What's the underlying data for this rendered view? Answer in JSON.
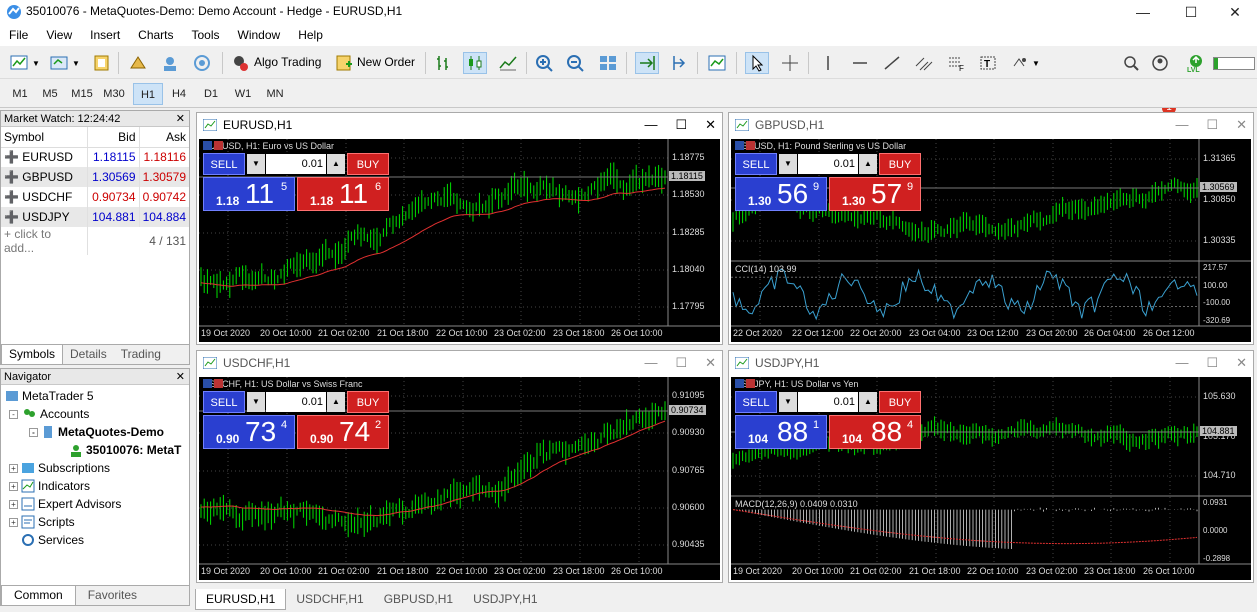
{
  "window": {
    "title": "35010076 - MetaQuotes-Demo: Demo Account - Hedge - EURUSD,H1"
  },
  "menu": [
    "File",
    "View",
    "Insert",
    "Charts",
    "Tools",
    "Window",
    "Help"
  ],
  "toolbar": {
    "algo_trading": "Algo Trading",
    "new_order": "New Order",
    "badge": "1",
    "lvl": "LVL"
  },
  "timeframes": [
    "M1",
    "M5",
    "M15",
    "M30",
    "H1",
    "H4",
    "D1",
    "W1",
    "MN"
  ],
  "selected_timeframe": "H1",
  "market_watch": {
    "title": "Market Watch: 12:24:42",
    "columns": [
      "Symbol",
      "Bid",
      "Ask"
    ],
    "rows": [
      {
        "symbol": "EURUSD",
        "bid": "1.18115",
        "ask": "1.18116",
        "dir": "down"
      },
      {
        "symbol": "GBPUSD",
        "bid": "1.30569",
        "ask": "1.30579",
        "dir": "up"
      },
      {
        "symbol": "USDCHF",
        "bid": "0.90734",
        "ask": "0.90742",
        "dir": "down"
      },
      {
        "symbol": "USDJPY",
        "bid": "104.881",
        "ask": "104.884",
        "dir": "up"
      }
    ],
    "add_label": "click to add...",
    "count": "4 / 131",
    "tabs": [
      "Symbols",
      "Details",
      "Trading"
    ]
  },
  "navigator": {
    "title": "Navigator",
    "root": "MetaTrader 5",
    "accounts": "Accounts",
    "server": "MetaQuotes-Demo",
    "account": "35010076: MetaT",
    "items": [
      "Subscriptions",
      "Indicators",
      "Expert Advisors",
      "Scripts",
      "Services"
    ],
    "tabs": [
      "Common",
      "Favorites"
    ]
  },
  "charts": [
    {
      "id": "eurusd",
      "title": "EURUSD,H1",
      "desc": "EURUSD, H1:  Euro vs US Dollar",
      "sell_prefix": "1.18",
      "sell_big": "11",
      "sell_sup": "5",
      "buy_prefix": "1.18",
      "buy_big": "11",
      "buy_sup": "6",
      "lot": "0.01",
      "sell": "SELL",
      "buy": "BUY",
      "prices": [
        "1.18775",
        "1.18530",
        "1.18285",
        "1.18040",
        "1.17795"
      ],
      "current": "1.18115",
      "times": [
        "19 Oct 2020",
        "20 Oct 10:00",
        "21 Oct 02:00",
        "21 Oct 18:00",
        "22 Oct 10:00",
        "23 Oct 02:00",
        "23 Oct 18:00",
        "26 Oct 10:00"
      ],
      "indicator": ""
    },
    {
      "id": "gbpusd",
      "title": "GBPUSD,H1",
      "desc": "GBPUSD, H1:  Pound Sterling vs US Dollar",
      "sell_prefix": "1.30",
      "sell_big": "56",
      "sell_sup": "9",
      "buy_prefix": "1.30",
      "buy_big": "57",
      "buy_sup": "9",
      "lot": "0.01",
      "sell": "SELL",
      "buy": "BUY",
      "prices": [
        "1.31365",
        "1.30850",
        "1.30335"
      ],
      "current": "1.30569",
      "times": [
        "22 Oct 2020",
        "22 Oct 12:00",
        "22 Oct 20:00",
        "23 Oct 04:00",
        "23 Oct 12:00",
        "23 Oct 20:00",
        "26 Oct 04:00",
        "26 Oct 12:00"
      ],
      "indicator": "CCI(14) 103.99",
      "ind_levels": [
        "217.57",
        "100.00",
        "-100.00",
        "-320.69"
      ]
    },
    {
      "id": "usdchf",
      "title": "USDCHF,H1",
      "desc": "USDCHF, H1:  US Dollar vs Swiss Franc",
      "sell_prefix": "0.90",
      "sell_big": "73",
      "sell_sup": "4",
      "buy_prefix": "0.90",
      "buy_big": "74",
      "buy_sup": "2",
      "lot": "0.01",
      "sell": "SELL",
      "buy": "BUY",
      "prices": [
        "0.91095",
        "0.90930",
        "0.90765",
        "0.90600",
        "0.90435"
      ],
      "current": "0.90734",
      "times": [
        "19 Oct 2020",
        "20 Oct 10:00",
        "21 Oct 02:00",
        "21 Oct 18:00",
        "22 Oct 10:00",
        "23 Oct 02:00",
        "23 Oct 18:00",
        "26 Oct 10:00"
      ],
      "indicator": ""
    },
    {
      "id": "usdjpy",
      "title": "USDJPY,H1",
      "desc": "USDJPY, H1:  US Dollar vs Yen",
      "sell_prefix": "104",
      "sell_big": "88",
      "sell_sup": "1",
      "buy_prefix": "104",
      "buy_big": "88",
      "buy_sup": "4",
      "lot": "0.01",
      "sell": "SELL",
      "buy": "BUY",
      "prices": [
        "105.630",
        "105.170",
        "104.710"
      ],
      "current": "104.881",
      "times": [
        "19 Oct 2020",
        "20 Oct 10:00",
        "21 Oct 02:00",
        "21 Oct 18:00",
        "22 Oct 10:00",
        "23 Oct 02:00",
        "23 Oct 18:00",
        "26 Oct 10:00"
      ],
      "indicator": "MACD(12,26,9) 0.0409 0.0310",
      "ind_levels": [
        "0.0931",
        "0.0000",
        "-0.2898"
      ]
    }
  ],
  "bottom_tabs": [
    "EURUSD,H1",
    "USDCHF,H1",
    "GBPUSD,H1",
    "USDJPY,H1"
  ]
}
